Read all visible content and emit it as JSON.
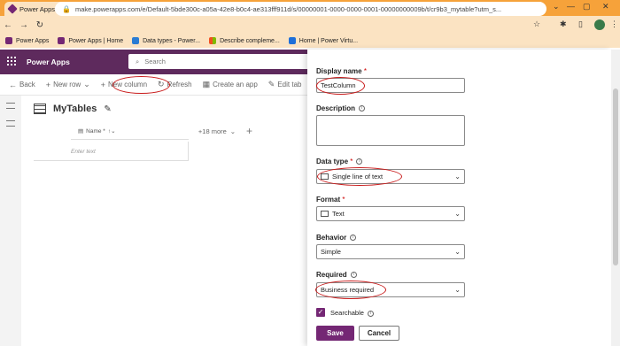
{
  "browser": {
    "tab_title": "Power Apps",
    "url": "make.powerapps.com/e/Default-5bde300c-a05a-42e8-b0c4-ae313fff911d/s/00000001-0000-0000-0001-00000000009b/t/cr9b3_mytable?utm_s...",
    "bookmarks": [
      "Power Apps",
      "Power Apps | Home",
      "Data types - Power...",
      "Describe compleme...",
      "Home | Power Virtu..."
    ]
  },
  "app": {
    "brand": "Power Apps",
    "search_placeholder": "Search"
  },
  "commands": {
    "back": "Back",
    "new_row": "New row",
    "new_column": "New column",
    "refresh": "Refresh",
    "create_app": "Create an app",
    "edit_table": "Edit tab"
  },
  "table": {
    "title": "MyTables",
    "column_header": "Name *",
    "more": "+18 more",
    "enter_text": "Enter text"
  },
  "panel": {
    "display_name_label": "Display name",
    "display_name_value": "TestColumn",
    "description_label": "Description",
    "data_type_label": "Data type",
    "data_type_value": "Single line of text",
    "format_label": "Format",
    "format_value": "Text",
    "behavior_label": "Behavior",
    "behavior_value": "Simple",
    "required_label": "Required",
    "required_value": "Business required",
    "searchable_label": "Searchable",
    "save": "Save",
    "cancel": "Cancel",
    "required_marker": "*"
  },
  "colors": {
    "brand_purple": "#742774",
    "header_purple": "#5e2a5d",
    "browser_orange": "#f6a23a",
    "annotation_red": "#c81a1a"
  }
}
